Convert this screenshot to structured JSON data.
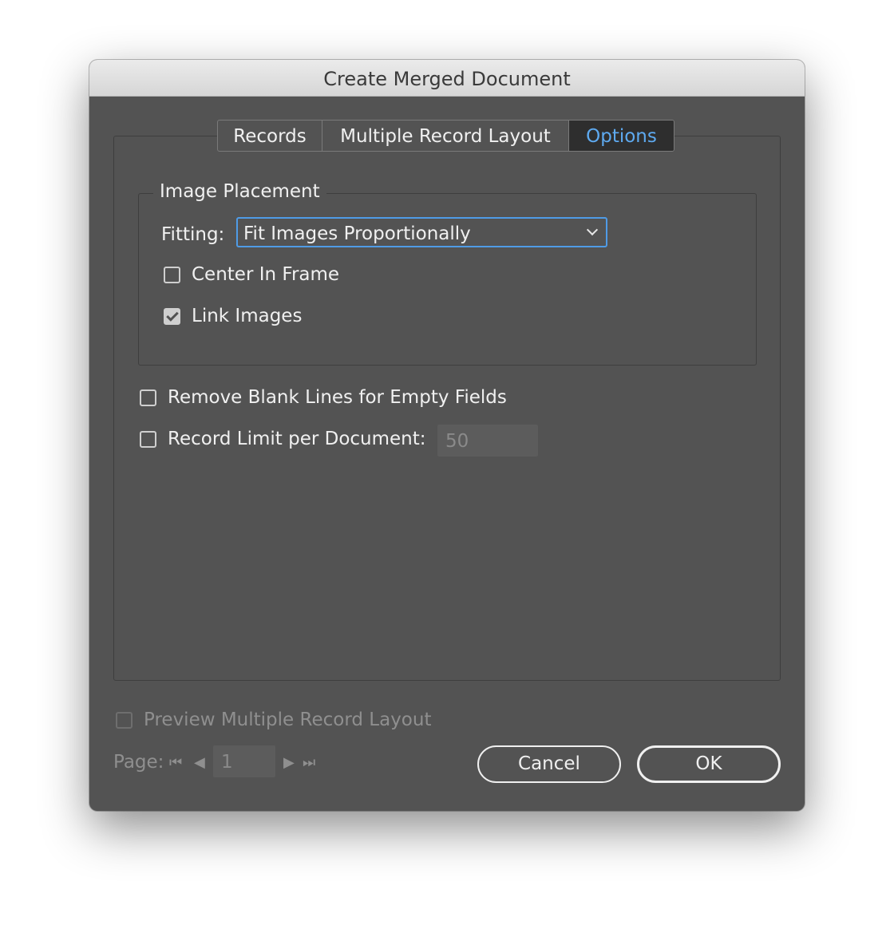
{
  "window": {
    "title": "Create Merged Document"
  },
  "tabs": [
    {
      "label": "Records",
      "active": false
    },
    {
      "label": "Multiple Record Layout",
      "active": false
    },
    {
      "label": "Options",
      "active": true
    }
  ],
  "image_placement": {
    "legend": "Image Placement",
    "fitting_label": "Fitting:",
    "fitting_value": "Fit Images Proportionally",
    "center_in_frame": {
      "label": "Center In Frame",
      "checked": false
    },
    "link_images": {
      "label": "Link Images",
      "checked": true
    }
  },
  "options": {
    "remove_blank_lines": {
      "label": "Remove Blank Lines for Empty Fields",
      "checked": false
    },
    "record_limit": {
      "label": "Record Limit per Document:",
      "checked": false,
      "value": "50"
    }
  },
  "preview": {
    "label": "Preview Multiple Record Layout",
    "checked": false,
    "enabled": false
  },
  "pager": {
    "label": "Page:",
    "value": "1"
  },
  "buttons": {
    "cancel": "Cancel",
    "ok": "OK"
  },
  "colors": {
    "accent": "#5eaaf0",
    "panel": "#535353",
    "focus_ring": "#4f9be6"
  }
}
